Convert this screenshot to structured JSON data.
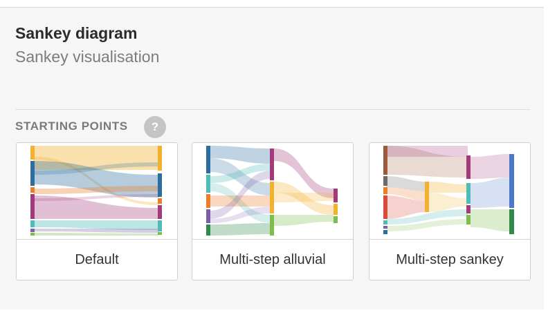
{
  "header": {
    "title": "Sankey diagram",
    "subtitle": "Sankey visualisation"
  },
  "section": {
    "label": "STARTING POINTS",
    "help_icon": "question-mark-icon",
    "help_glyph": "?"
  },
  "cards": [
    {
      "label": "Default"
    },
    {
      "label": "Multi-step alluvial"
    },
    {
      "label": "Multi-step sankey"
    }
  ],
  "colors": {
    "yellow": "#f2b12f",
    "blue": "#2d6e9e",
    "magenta": "#a23a7c",
    "teal": "#4fbcb7",
    "orange": "#ea7f2b",
    "purple": "#7c5ea9",
    "green": "#2f8a4c",
    "lightgreen": "#7dbd4d",
    "brown": "#9b5a3a",
    "red": "#d84a3a",
    "gray": "#6b6b6b",
    "royal": "#4b78c8"
  }
}
